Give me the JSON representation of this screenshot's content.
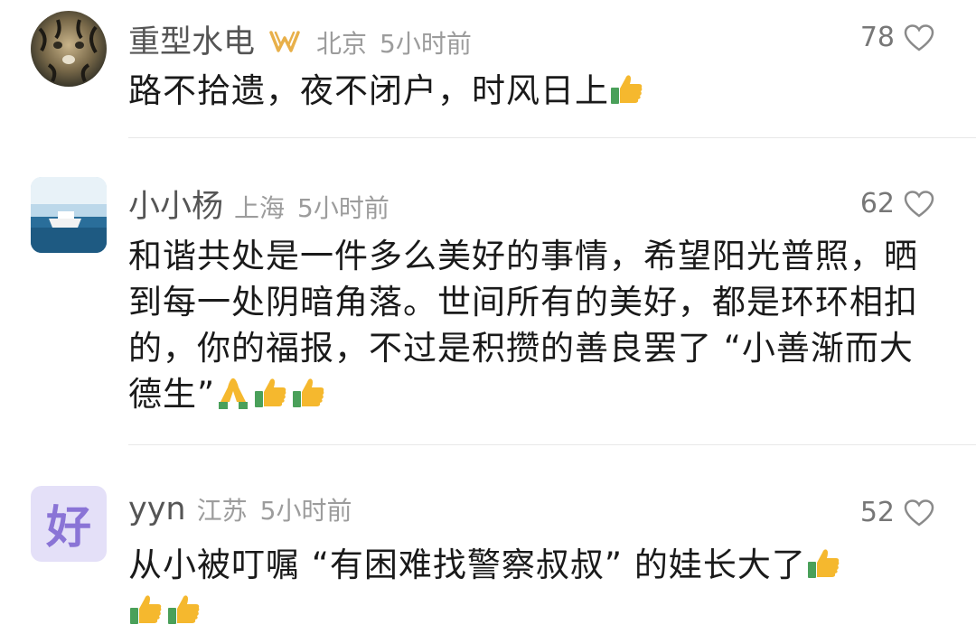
{
  "comments": [
    {
      "username": "重型水电",
      "has_badge": true,
      "location": "北京",
      "time": "5小时前",
      "likes": "78",
      "text": "路不拾遗，夜不闭户，时风日上",
      "emojis": [
        "thumbs-up"
      ]
    },
    {
      "username": "小小杨",
      "has_badge": false,
      "location": "上海",
      "time": "5小时前",
      "likes": "62",
      "text": "和谐共处是一件多么美好的事情，希望阳光普照，晒到每一处阴暗角落。世间所有的美好，都是环环相扣的，你的福报，不过是积攒的善良罢了 “小善渐而大德生”",
      "emojis": [
        "folded-hands",
        "thumbs-up",
        "thumbs-up"
      ]
    },
    {
      "username": "yyn",
      "has_badge": false,
      "location": "江苏",
      "time": "5小时前",
      "likes": "52",
      "text": "从小被叮嘱 “有困难找警察叔叔” 的娃长大了",
      "emojis": [
        "thumbs-up",
        "thumbs-up",
        "thumbs-up"
      ],
      "avatar_char": "好"
    }
  ],
  "colors": {
    "avatar3_bg": "#e4e0f8",
    "avatar3_fg": "#8a74d6",
    "badge": "#e8b04a",
    "thumb": "#f5b82e",
    "cuff": "#4aa05a"
  }
}
